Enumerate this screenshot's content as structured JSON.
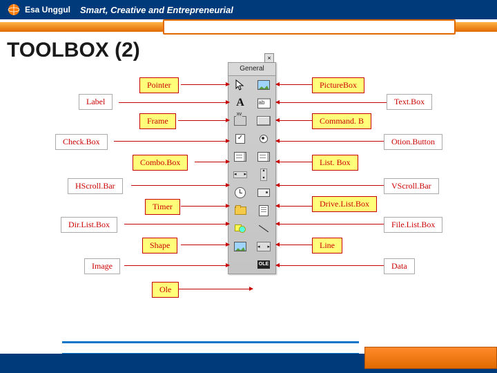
{
  "header": {
    "university": "Esa Unggul",
    "tagline": "Smart, Creative and Entrepreneurial"
  },
  "title": "TOOLBOX (2)",
  "toolbox_title": "General",
  "labels": {
    "pointer": "Pointer",
    "picturebox": "PictureBox",
    "label": "Label",
    "textbox": "Text.Box",
    "frame": "Frame",
    "cmd": "Command. B",
    "checkbox": "Check.Box",
    "option": "Otion.Button",
    "combo": "Combo.Box",
    "listbox": "List. Box",
    "hscroll": "HScroll.Bar",
    "vscroll": "VScroll.Bar",
    "timer": "Timer",
    "drive": "Drive.List.Box",
    "dirlist": "Dir.List.Box",
    "filelist": "File.List.Box",
    "shape": "Shape",
    "line": "Line",
    "image": "Image",
    "data": "Data",
    "ole": "Ole"
  }
}
